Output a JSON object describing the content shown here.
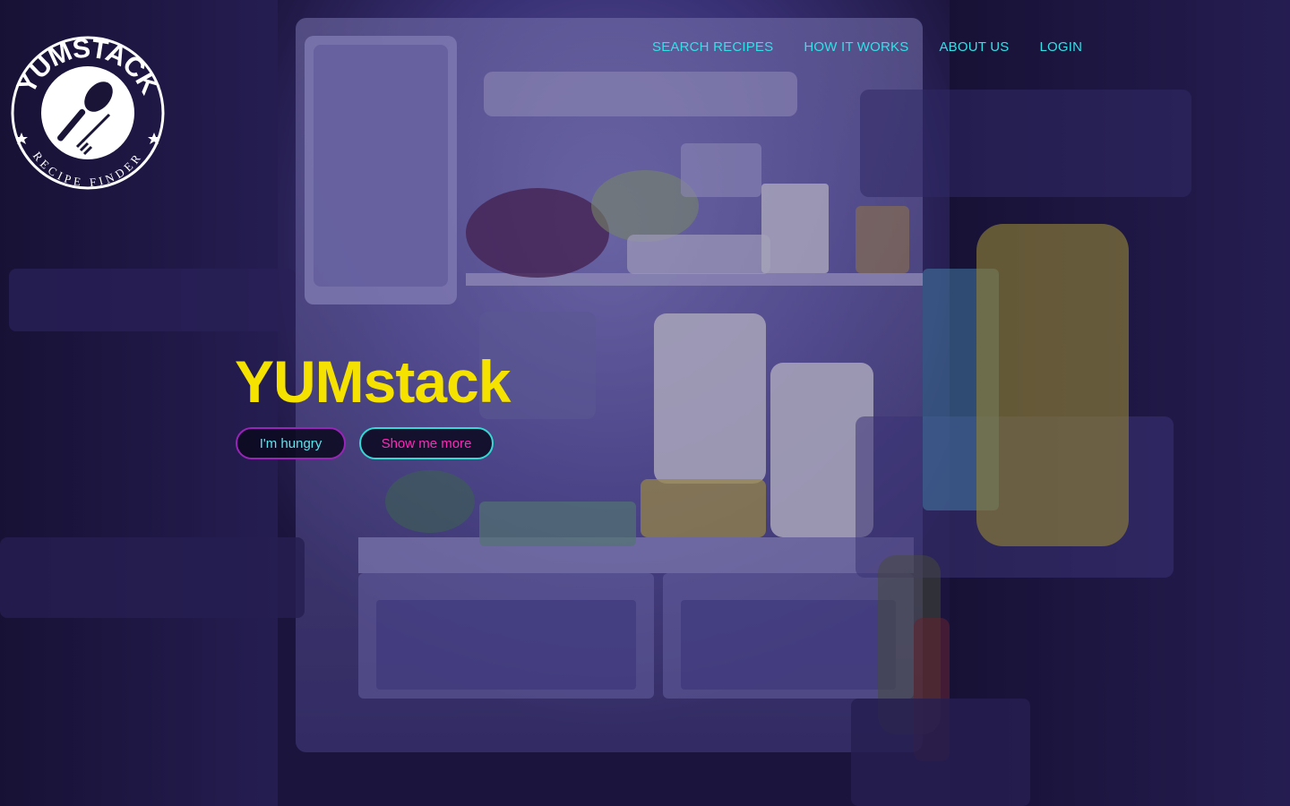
{
  "logo": {
    "brand_text": "YUMSTACK",
    "tagline_text": "RECIPE FINDER"
  },
  "nav": {
    "items": [
      {
        "label": "SEARCH RECIPES"
      },
      {
        "label": "HOW IT WORKS"
      },
      {
        "label": "ABOUT US"
      },
      {
        "label": "LOGIN"
      }
    ]
  },
  "hero": {
    "title": "YUMstack",
    "buttons": {
      "hungry_label": "I'm hungry",
      "more_label": "Show me more"
    }
  },
  "colors": {
    "nav_text": "#33e0e6",
    "title": "#f5e200",
    "hungry_border": "#9a24b8",
    "more_border": "#33d9d2",
    "more_text": "#ff2ab8",
    "overlay": "#1e1446"
  },
  "icons": [
    "spoon-icon",
    "fork-icon",
    "star-icon"
  ]
}
